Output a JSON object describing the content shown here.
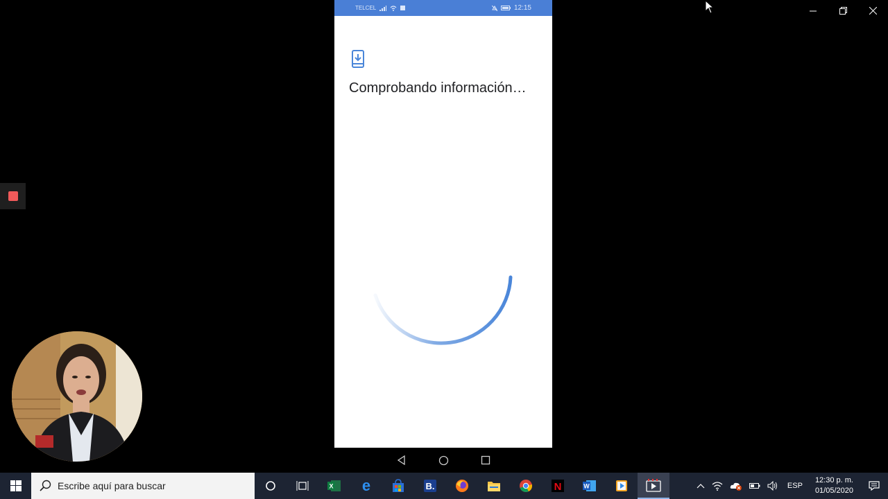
{
  "window": {
    "minimize": "—",
    "restore": "❐",
    "close": "✕"
  },
  "phone": {
    "status_bar": {
      "carrier": "TELCEL",
      "time": "12:15"
    },
    "heading": "Comprobando información…"
  },
  "taskbar": {
    "search_placeholder": "Escribe aquí para buscar",
    "apps": [
      "cortana",
      "task-view",
      "excel",
      "edge",
      "store",
      "booking",
      "firefox",
      "file-explorer",
      "chrome",
      "netflix",
      "word",
      "media-player",
      "video-editor"
    ],
    "tray": {
      "language": "ESP",
      "time": "12:30 p. m.",
      "date": "01/05/2020"
    }
  },
  "colors": {
    "accent": "#4a7fd6",
    "spinner": "#4a86d9",
    "taskbar": "#1d2433"
  }
}
